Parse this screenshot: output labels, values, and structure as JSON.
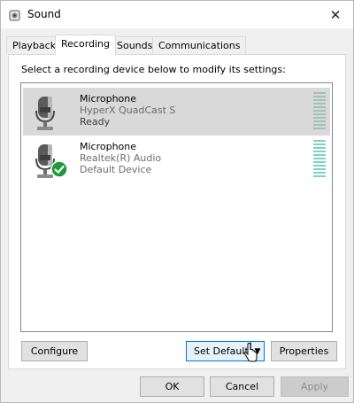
{
  "window": {
    "title": "Sound",
    "close_glyph": "✕"
  },
  "tabs": [
    {
      "label": "Playback",
      "active": false
    },
    {
      "label": "Recording",
      "active": true
    },
    {
      "label": "Sounds",
      "active": false
    },
    {
      "label": "Communications",
      "active": false
    }
  ],
  "panel": {
    "instruction": "Select a recording device below to modify its settings:"
  },
  "devices": [
    {
      "name": "Microphone",
      "driver": "HyperX QuadCast S",
      "status": "Ready",
      "selected": true,
      "icon": "microphone-icon",
      "default": false
    },
    {
      "name": "Microphone",
      "driver": "Realtek(R) Audio",
      "status": "Default Device",
      "selected": false,
      "icon": "microphone-icon",
      "default": true
    }
  ],
  "panel_buttons": {
    "configure": "Configure",
    "set_default": "Set Default",
    "set_default_arrow": "▼",
    "properties": "Properties"
  },
  "dialog_buttons": {
    "ok": "OK",
    "cancel": "Cancel",
    "apply": "Apply"
  },
  "colors": {
    "accent": "#0078d7",
    "selection": "#d9d9d9",
    "default_check": "#1e9a3a",
    "meter": "#7ed4c2"
  }
}
